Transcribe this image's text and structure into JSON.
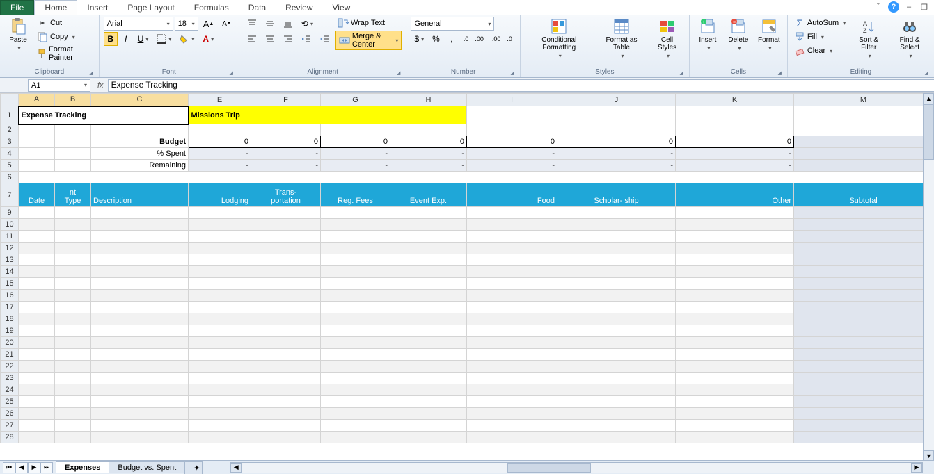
{
  "window": {
    "help": "?",
    "caret": "ˇ",
    "min": "–",
    "restore": "❐"
  },
  "tabs": {
    "file": "File",
    "items": [
      "Home",
      "Insert",
      "Page Layout",
      "Formulas",
      "Data",
      "Review",
      "View"
    ],
    "active": "Home"
  },
  "ribbon": {
    "clipboard": {
      "paste": "Paste",
      "cut": "Cut",
      "copy": "Copy",
      "painter": "Format Painter",
      "label": "Clipboard"
    },
    "font": {
      "name": "Arial",
      "size": "18",
      "label": "Font"
    },
    "alignment": {
      "wrap": "Wrap Text",
      "merge": "Merge & Center",
      "label": "Alignment"
    },
    "number": {
      "format": "General",
      "label": "Number"
    },
    "styles": {
      "cond": "Conditional\nFormatting",
      "table": "Format\nas Table",
      "cell": "Cell\nStyles",
      "label": "Styles"
    },
    "cells": {
      "insert": "Insert",
      "delete": "Delete",
      "format": "Format",
      "label": "Cells"
    },
    "editing": {
      "autosum": "AutoSum",
      "fill": "Fill",
      "clear": "Clear",
      "sort": "Sort &\nFilter",
      "find": "Find &\nSelect",
      "label": "Editing"
    }
  },
  "namebox": "A1",
  "formula": "Expense Tracking",
  "columns": [
    "A",
    "B",
    "C",
    "E",
    "F",
    "G",
    "H",
    "I",
    "J",
    "K",
    "M"
  ],
  "sheet": {
    "title": "Expense Tracking",
    "trip": "Missions Trip",
    "budget_label": "Budget",
    "spent_label": "% Spent",
    "remain_label": "Remaining",
    "zero": "0",
    "dash": "-",
    "hdr": {
      "date": "Date",
      "nt": "nt",
      "type": "Type",
      "desc": "Description",
      "lodging": "Lodging",
      "trans1": "Trans-",
      "trans2": "portation",
      "reg": "Reg. Fees",
      "event": "Event Exp.",
      "food": "Food",
      "scholar": "Scholar- ship",
      "other": "Other",
      "subtotal": "Subtotal"
    }
  },
  "sheets": {
    "s1": "Expenses",
    "s2": "Budget vs. Spent"
  }
}
